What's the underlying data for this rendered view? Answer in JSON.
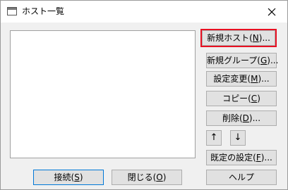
{
  "window": {
    "title": "ホスト一覧",
    "icons": {
      "app": "window-icon",
      "close": "close-icon"
    }
  },
  "buttons": {
    "new_host": {
      "pre": "新規ホスト(",
      "key": "N",
      "post": ")..."
    },
    "new_group": {
      "pre": "新規グループ(",
      "key": "G",
      "post": ")..."
    },
    "edit": {
      "pre": "設定変更(",
      "key": "M",
      "post": ")..."
    },
    "copy": {
      "pre": "コピー(",
      "key": "C",
      "post": ")"
    },
    "delete": {
      "pre": "削除(",
      "key": "D",
      "post": ")..."
    },
    "move_up": "↑",
    "move_down": "↓",
    "default_settings": {
      "pre": "既定の設定(",
      "key": "F",
      "post": ")..."
    },
    "help": "ヘルプ",
    "connect": {
      "pre": "接続(",
      "key": "S",
      "post": ")"
    },
    "close": {
      "pre": "閉じる(",
      "key": "O",
      "post": ")"
    }
  },
  "colors": {
    "focus_highlight": "#e81123",
    "default_button_border": "#0078d7"
  }
}
